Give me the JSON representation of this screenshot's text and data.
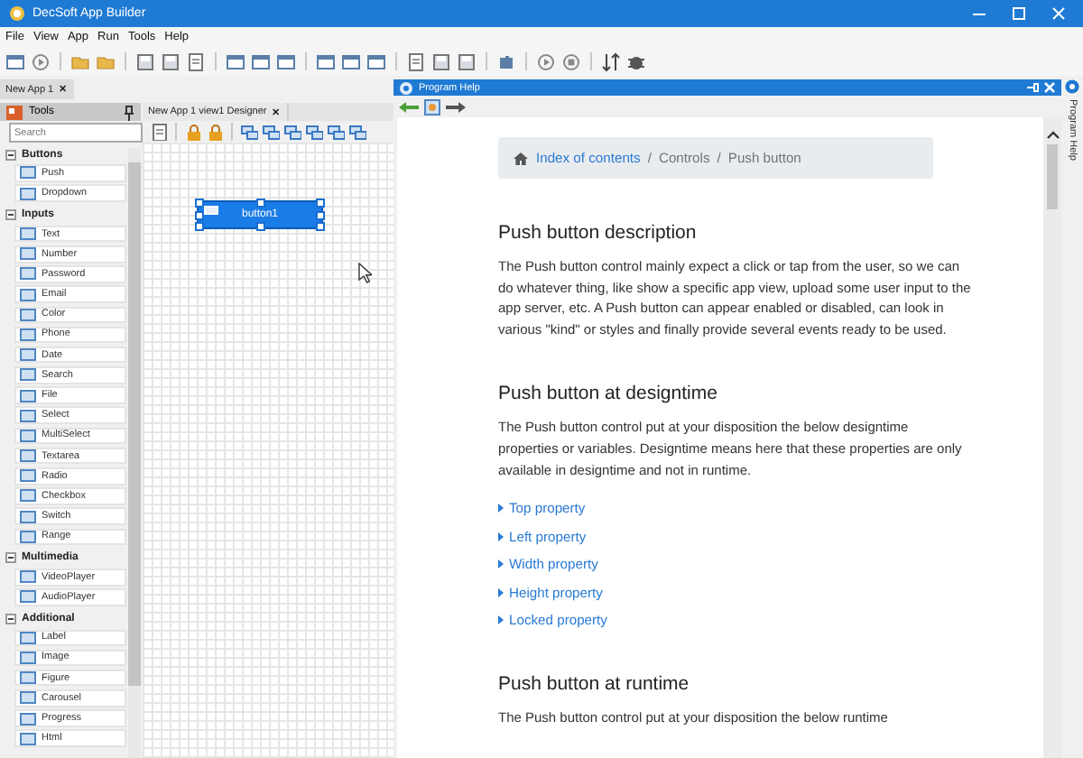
{
  "window": {
    "title": "DecSoft App Builder"
  },
  "menu": [
    "File",
    "View",
    "App",
    "Run",
    "Tools",
    "Help"
  ],
  "document_tab": {
    "label": "New App 1",
    "close": "✕"
  },
  "tools_panel": {
    "title": "Tools",
    "search": {
      "placeholder": "Search"
    },
    "groups": [
      {
        "label": "Buttons",
        "expanded": true,
        "items": [
          "Push",
          "Dropdown"
        ]
      },
      {
        "label": "Inputs",
        "expanded": true,
        "items": [
          "Text",
          "Number",
          "Password",
          "Email",
          "Color",
          "Phone",
          "Date",
          "Search",
          "File",
          "Select",
          "MultiSelect",
          "Textarea",
          "Radio",
          "Checkbox",
          "Switch",
          "Range"
        ]
      },
      {
        "label": "Multimedia",
        "expanded": true,
        "items": [
          "VideoPlayer",
          "AudioPlayer"
        ]
      },
      {
        "label": "Additional",
        "expanded": true,
        "items": [
          "Label",
          "Image",
          "Figure",
          "Carousel",
          "Progress",
          "Html"
        ]
      }
    ]
  },
  "designer": {
    "tab": "New App 1 view1 Designer",
    "close": "✕",
    "control": {
      "label": "button1",
      "selected": true
    }
  },
  "help": {
    "title": "Program Help",
    "side_tab": "Program Help",
    "breadcrumb": [
      {
        "kind": "link",
        "text": "Index of contents"
      },
      {
        "kind": "separator",
        "text": "/"
      },
      {
        "kind": "text",
        "text": "Controls"
      },
      {
        "kind": "separator",
        "text": "/"
      },
      {
        "kind": "text",
        "text": "Push button"
      }
    ],
    "sections": [
      {
        "heading": "Push button description",
        "paragraph": "The Push button control mainly expect a click or tap from the user, so we can do whatever thing, like show a specific app view, upload some user input to the app server, etc. A Push button can appear enabled or disabled, can look in various \"kind\" or styles and finally provide several events ready to be used."
      },
      {
        "heading": "Push button at designtime",
        "paragraph": "The Push button control put at your disposition the below designtime properties or variables. Designtime means here that these properties are only available in designtime and not in runtime.",
        "links": [
          "Top property",
          "Left property",
          "Width property",
          "Height property",
          "Locked property"
        ]
      },
      {
        "heading": "Push button at runtime",
        "paragraph": "The Push button control put at your disposition the below runtime"
      }
    ]
  }
}
